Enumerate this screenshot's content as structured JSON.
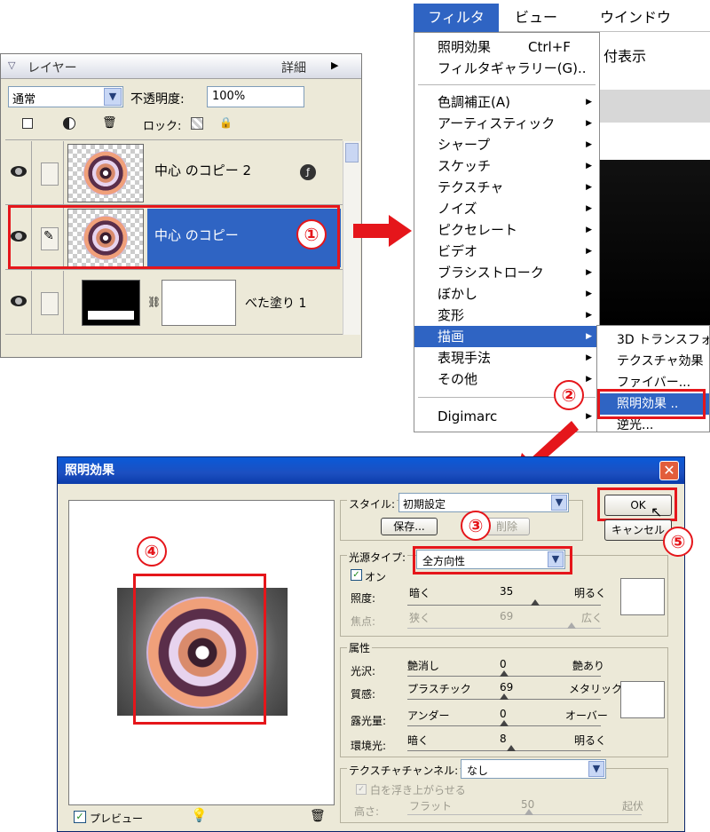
{
  "layers_panel": {
    "title": "レイヤー",
    "detail_label": "詳細",
    "blend_mode": "通常",
    "opacity_label": "不透明度:",
    "opacity_value": "100%",
    "lock_label": "ロック:",
    "layers": [
      {
        "name": "中心 のコピー 2",
        "active": false
      },
      {
        "name": "中心 のコピー",
        "active": true
      },
      {
        "name": "べた塗り 1",
        "active": false
      }
    ]
  },
  "menubar": {
    "items": [
      "フィルタ",
      "ビュー",
      "ウインドウ"
    ],
    "behind_text": "付表示"
  },
  "filter_menu": {
    "top_items": [
      {
        "label": "照明効果",
        "shortcut": "Ctrl+F"
      },
      {
        "label": "フィルタギャラリー(G)..",
        "shortcut": ""
      }
    ],
    "categories": [
      "色調補正(A)",
      "アーティスティック",
      "シャープ",
      "スケッチ",
      "テクスチャ",
      "ノイズ",
      "ピクセレート",
      "ビデオ",
      "ブラシストローク",
      "ぼかし",
      "変形",
      "描画",
      "表現手法",
      "その他"
    ],
    "highlighted": "描画",
    "bottom_item": "Digimarc"
  },
  "render_submenu": {
    "items": [
      "3D トランスフォ",
      "テクスチャ効果",
      "ファイバー...",
      "照明効果 ..",
      "逆光..."
    ],
    "highlighted": "照明効果 .."
  },
  "steps": [
    "①",
    "②",
    "③",
    "④",
    "⑤"
  ],
  "dialog": {
    "title": "照明効果",
    "close": "✕",
    "style_label": "スタイル:",
    "style_value": "初期設定",
    "save_button": "保存...",
    "delete_button": "削除",
    "ok_button": "OK",
    "cancel_button": "キャンセル",
    "light_type_label": "光源タイプ:",
    "light_type_value": "全方向性",
    "on_label": "オン",
    "intensity": {
      "label": "照度:",
      "min": "暗く",
      "value": "35",
      "max": "明るく"
    },
    "focus": {
      "label": "焦点:",
      "min": "狭く",
      "value": "69",
      "max": "広く"
    },
    "properties_label": "属性",
    "gloss": {
      "label": "光沢:",
      "min": "艶消し",
      "value": "0",
      "max": "艶あり"
    },
    "material": {
      "label": "質感:",
      "min": "プラスチック",
      "value": "69",
      "max": "メタリック"
    },
    "exposure": {
      "label": "露光量:",
      "min": "アンダー",
      "value": "0",
      "max": "オーバー"
    },
    "ambience": {
      "label": "環境光:",
      "min": "暗く",
      "value": "8",
      "max": "明るく"
    },
    "texture_channel_label": "テクスチャチャンネル:",
    "texture_channel_value": "なし",
    "white_high_label": "白を浮き上がらせる",
    "height": {
      "label": "高さ:",
      "min": "フラット",
      "value": "50",
      "max": "起伏"
    },
    "preview_label": "プレビュー"
  },
  "colors": {
    "accent": "#2f64c3",
    "highlight_red": "#e5161b",
    "dialog_bg": "#ece9d8"
  }
}
